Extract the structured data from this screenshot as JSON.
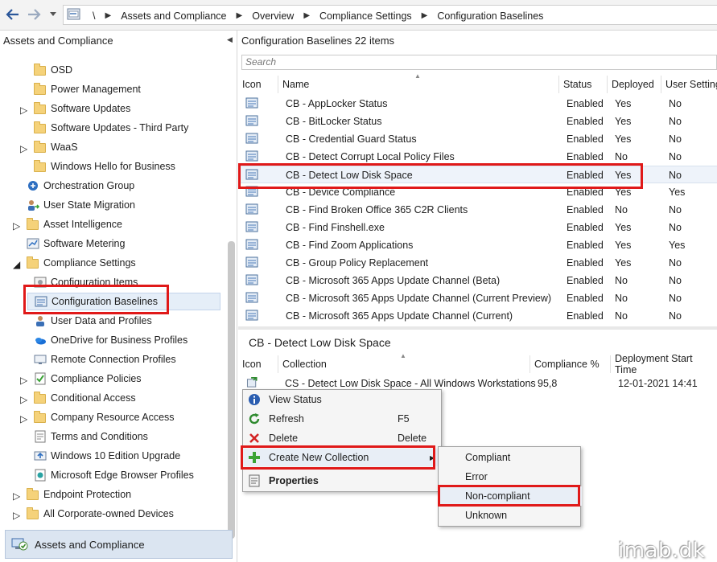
{
  "address_bar": {
    "root": "\\",
    "crumbs": [
      "Assets and Compliance",
      "Overview",
      "Compliance Settings",
      "Configuration Baselines"
    ]
  },
  "left_panel": {
    "title": "Assets and Compliance",
    "items": [
      {
        "label": "OSD",
        "icon": "folder-icon",
        "indent": 2,
        "arrow": ""
      },
      {
        "label": "Power Management",
        "icon": "folder-icon",
        "indent": 2,
        "arrow": ""
      },
      {
        "label": "Software Updates",
        "icon": "folder-icon",
        "indent": 2,
        "arrow": "right"
      },
      {
        "label": "Software Updates - Third Party",
        "icon": "folder-icon",
        "indent": 2,
        "arrow": ""
      },
      {
        "label": "WaaS",
        "icon": "folder-icon",
        "indent": 2,
        "arrow": "right"
      },
      {
        "label": "Windows Hello for Business",
        "icon": "folder-icon",
        "indent": 2,
        "arrow": ""
      },
      {
        "label": "Orchestration Group",
        "icon": "orchestration-icon",
        "indent": 1,
        "arrow": ""
      },
      {
        "label": "User State Migration",
        "icon": "user-migration-icon",
        "indent": 1,
        "arrow": ""
      },
      {
        "label": "Asset Intelligence",
        "icon": "folder-icon",
        "indent": 1,
        "arrow": "right"
      },
      {
        "label": "Software Metering",
        "icon": "metering-icon",
        "indent": 1,
        "arrow": ""
      },
      {
        "label": "Compliance Settings",
        "icon": "folder-icon",
        "indent": 1,
        "arrow": "down"
      },
      {
        "label": "Configuration Items",
        "icon": "config-item-icon",
        "indent": 2,
        "arrow": ""
      },
      {
        "label": "Configuration Baselines",
        "icon": "baseline-icon",
        "indent": 2,
        "arrow": "",
        "selected": true
      },
      {
        "label": "User Data and Profiles",
        "icon": "user-data-icon",
        "indent": 2,
        "arrow": ""
      },
      {
        "label": "OneDrive for Business Profiles",
        "icon": "onedrive-icon",
        "indent": 2,
        "arrow": ""
      },
      {
        "label": "Remote Connection Profiles",
        "icon": "remote-connection-icon",
        "indent": 2,
        "arrow": ""
      },
      {
        "label": "Compliance Policies",
        "icon": "compliance-policy-icon",
        "indent": 2,
        "arrow": "right"
      },
      {
        "label": "Conditional Access",
        "icon": "folder-icon",
        "indent": 2,
        "arrow": "right"
      },
      {
        "label": "Company Resource Access",
        "icon": "folder-icon",
        "indent": 2,
        "arrow": "right"
      },
      {
        "label": "Terms and Conditions",
        "icon": "terms-icon",
        "indent": 2,
        "arrow": ""
      },
      {
        "label": "Windows 10 Edition Upgrade",
        "icon": "upgrade-icon",
        "indent": 2,
        "arrow": ""
      },
      {
        "label": "Microsoft Edge Browser Profiles",
        "icon": "edge-profile-icon",
        "indent": 2,
        "arrow": ""
      },
      {
        "label": "Endpoint Protection",
        "icon": "folder-icon",
        "indent": 1,
        "arrow": "right"
      },
      {
        "label": "All Corporate-owned Devices",
        "icon": "folder-icon",
        "indent": 1,
        "arrow": "right"
      }
    ],
    "workspace_label": "Assets and Compliance"
  },
  "main": {
    "header": "Configuration Baselines 22 items",
    "search_placeholder": "Search",
    "columns": [
      "Icon",
      "Name",
      "Status",
      "Deployed",
      "User Setting"
    ],
    "rows": [
      {
        "name": "CB - AppLocker Status",
        "status": "Enabled",
        "deployed": "Yes",
        "user": "No"
      },
      {
        "name": "CB - BitLocker Status",
        "status": "Enabled",
        "deployed": "Yes",
        "user": "No"
      },
      {
        "name": "CB - Credential Guard Status",
        "status": "Enabled",
        "deployed": "Yes",
        "user": "No"
      },
      {
        "name": "CB - Detect Corrupt Local Policy Files",
        "status": "Enabled",
        "deployed": "No",
        "user": "No"
      },
      {
        "name": "CB - Detect Low Disk Space",
        "status": "Enabled",
        "deployed": "Yes",
        "user": "No",
        "selected": true
      },
      {
        "name": "CB - Device Compliance",
        "status": "Enabled",
        "deployed": "Yes",
        "user": "Yes"
      },
      {
        "name": "CB - Find Broken Office 365 C2R Clients",
        "status": "Enabled",
        "deployed": "No",
        "user": "No"
      },
      {
        "name": "CB - Find Finshell.exe",
        "status": "Enabled",
        "deployed": "Yes",
        "user": "No"
      },
      {
        "name": "CB - Find Zoom Applications",
        "status": "Enabled",
        "deployed": "Yes",
        "user": "Yes"
      },
      {
        "name": "CB - Group Policy Replacement",
        "status": "Enabled",
        "deployed": "Yes",
        "user": "No"
      },
      {
        "name": "CB - Microsoft 365 Apps Update Channel (Beta)",
        "status": "Enabled",
        "deployed": "No",
        "user": "No"
      },
      {
        "name": "CB - Microsoft 365 Apps Update Channel (Current Preview)",
        "status": "Enabled",
        "deployed": "No",
        "user": "No"
      },
      {
        "name": "CB - Microsoft 365 Apps Update Channel (Current)",
        "status": "Enabled",
        "deployed": "No",
        "user": "No"
      }
    ]
  },
  "detail": {
    "title": "CB - Detect Low Disk Space",
    "columns": [
      "Icon",
      "Collection",
      "Compliance %",
      "Deployment Start Time"
    ],
    "row": {
      "collection": "CS - Detect Low Disk Space - All Windows Workstations",
      "compliance": "95,8",
      "start": "12-01-2021 14:41"
    }
  },
  "context_menu": {
    "items": [
      {
        "label": "View Status",
        "shortcut": "",
        "icon": "info-icon"
      },
      {
        "label": "Refresh",
        "shortcut": "F5",
        "icon": "refresh-icon"
      },
      {
        "label": "Delete",
        "shortcut": "Delete",
        "icon": "delete-icon"
      },
      {
        "label": "Create New Collection",
        "shortcut": "",
        "icon": "add-icon",
        "submenu": true
      },
      {
        "label": "Properties",
        "shortcut": "",
        "icon": "properties-icon",
        "bold": true
      }
    ],
    "submenu": [
      "Compliant",
      "Error",
      "Non-compliant",
      "Unknown"
    ]
  },
  "watermark": "imab.dk",
  "colors": {
    "highlight_box": "#e01919",
    "selection": "#e5eef8",
    "folder": "#f5d27a"
  }
}
